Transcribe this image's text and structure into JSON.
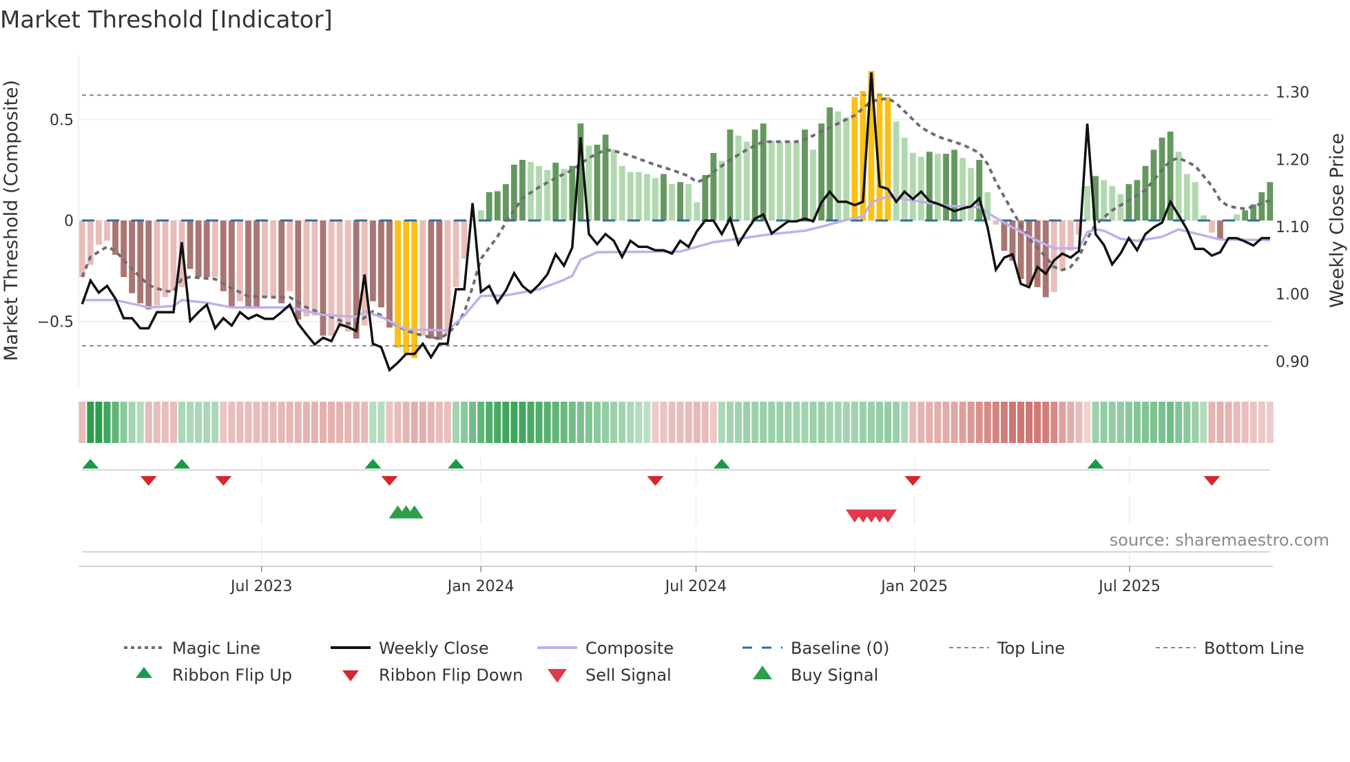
{
  "title": "Market Threshold [Indicator]",
  "source": "source: sharemaestro.com",
  "chart_data": {
    "type": "bar",
    "title": "Market Threshold [Indicator]",
    "ylabel_left": "Market Threshold (Composite)",
    "ylabel_right": "Weekly Close Price",
    "ylim_left": [
      -0.8,
      0.8
    ],
    "ylim_right": [
      0.87,
      1.34
    ],
    "left_ticks": [
      {
        "v": 0.5,
        "label": "0.5"
      },
      {
        "v": 0,
        "label": "0"
      },
      {
        "v": -0.5,
        "label": "−0.5"
      }
    ],
    "right_ticks": [
      {
        "v": 1.3,
        "label": "1.30"
      },
      {
        "v": 1.2,
        "label": "1.20"
      },
      {
        "v": 1.1,
        "label": "1.10"
      },
      {
        "v": 1.0,
        "label": "1.00"
      },
      {
        "v": 0.9,
        "label": "0.90"
      }
    ],
    "x_unit": "week index (1 = first weekly bar)",
    "x_ticks": [
      {
        "week": 22.6,
        "label": "Jul 2023"
      },
      {
        "week": 49.0,
        "label": "Jan 2024"
      },
      {
        "week": 74.9,
        "label": "Jul 2024"
      },
      {
        "week": 101.2,
        "label": "Jan 2025"
      },
      {
        "week": 127.1,
        "label": "Jul 2025"
      }
    ],
    "top_line": 0.62,
    "bottom_line": -0.62,
    "baseline": 0,
    "colors": {
      "bar_pos_dark": "#64985f",
      "bar_pos_light": "#b1d9ae",
      "bar_neg_dark": "#ab7572",
      "bar_neg_light": "#ebbdb8",
      "bar_extreme": "#fbc012",
      "weekly_close": "#111111",
      "composite": "#bcb1ec",
      "magic": "#6d6d74",
      "baseline": "#2e6e9e",
      "threshold": "#888888",
      "ribbon_up": "#2e9e4e",
      "ribbon_down": "#c55a56",
      "flip_up": "#1a9a48",
      "flip_down": "#d7262b",
      "buy": "#2ca048",
      "sell": "#e13a4c"
    },
    "composite_bars": [
      -0.28,
      -0.22,
      -0.12,
      -0.1,
      -0.17,
      -0.28,
      -0.36,
      -0.41,
      -0.44,
      -0.42,
      -0.38,
      -0.35,
      -0.33,
      -0.24,
      -0.28,
      -0.28,
      -0.28,
      -0.35,
      -0.43,
      -0.4,
      -0.43,
      -0.43,
      -0.38,
      -0.375,
      -0.41,
      -0.35,
      -0.49,
      -0.475,
      -0.47,
      -0.57,
      -0.57,
      -0.53,
      -0.55,
      -0.585,
      -0.52,
      -0.4,
      -0.43,
      -0.53,
      -0.63,
      -0.66,
      -0.68,
      -0.57,
      -0.585,
      -0.59,
      -0.56,
      -0.33,
      -0.19,
      0,
      0.05,
      0.14,
      0.145,
      0.18,
      0.276,
      0.3,
      0.29,
      0.27,
      0.25,
      0.286,
      0.255,
      0.27,
      0.48,
      0.37,
      0.375,
      0.425,
      0.35,
      0.27,
      0.24,
      0.24,
      0.23,
      0.21,
      0.23,
      0.18,
      0.19,
      0.18,
      0.09,
      0.225,
      0.334,
      0.295,
      0.45,
      0.42,
      0.39,
      0.45,
      0.48,
      0.395,
      0.39,
      0.39,
      0.386,
      0.45,
      0.35,
      0.48,
      0.56,
      0.54,
      0.51,
      0.61,
      0.64,
      0.74,
      0.63,
      0.61,
      0.49,
      0.41,
      0.335,
      0.315,
      0.34,
      0.33,
      0.33,
      0.35,
      0.31,
      0.26,
      0.3,
      0.14,
      -0.02,
      -0.15,
      -0.2,
      -0.29,
      -0.32,
      -0.33,
      -0.38,
      -0.355,
      -0.25,
      -0.15,
      -0.07,
      0.17,
      0.22,
      0.2,
      0.17,
      0.13,
      0.18,
      0.2,
      0.27,
      0.35,
      0.41,
      0.44,
      0.34,
      0.23,
      0.19,
      0.025,
      -0.06,
      -0.09,
      0,
      0.03,
      0.05,
      0.08,
      0.14,
      0.19
    ],
    "bar_shade": "LLLLDDDDDLLLLDDDLDDLDDLLDLDLLDLLLDLDDDYYYLDDLLLLLDDDDDLLLDLDDLDDLLLLLLDLDLLDDLDLLDDLLLLDLDDLLYYYYYLLLLDLDDLLDLLDDDDDDLLLLLDLLLDDDDDDLLLLLDLLDDDD",
    "weekly_close": [
      0.985,
      1.02,
      1.002,
      1.012,
      0.993,
      0.964,
      0.964,
      0.949,
      0.949,
      0.973,
      0.973,
      0.973,
      1.077,
      0.96,
      0.973,
      0.984,
      0.949,
      0.964,
      0.953,
      0.973,
      0.963,
      0.969,
      0.963,
      0.963,
      0.973,
      0.984,
      0.956,
      0.94,
      0.925,
      0.935,
      0.93,
      0.955,
      0.951,
      0.945,
      1.029,
      0.926,
      0.921,
      0.887,
      0.898,
      0.911,
      0.911,
      0.926,
      0.906,
      0.926,
      0.926,
      1.007,
      1.007,
      1.135,
      1.003,
      1.012,
      0.987,
      1.005,
      1.031,
      1.012,
      1.002,
      1.014,
      1.029,
      1.059,
      1.042,
      1.069,
      1.233,
      1.089,
      1.074,
      1.089,
      1.079,
      1.055,
      1.079,
      1.07,
      1.07,
      1.065,
      1.065,
      1.06,
      1.079,
      1.07,
      1.093,
      1.109,
      1.109,
      1.089,
      1.112,
      1.074,
      1.094,
      1.112,
      1.118,
      1.09,
      1.099,
      1.108,
      1.108,
      1.112,
      1.108,
      1.136,
      1.152,
      1.137,
      1.137,
      1.132,
      1.137,
      1.329,
      1.16,
      1.156,
      1.137,
      1.152,
      1.141,
      1.152,
      1.138,
      1.134,
      1.129,
      1.123,
      1.127,
      1.13,
      1.142,
      1.099,
      1.036,
      1.054,
      1.059,
      1.015,
      1.01,
      1.04,
      1.03,
      1.05,
      1.06,
      1.054,
      1.064,
      1.253,
      1.089,
      1.073,
      1.044,
      1.06,
      1.083,
      1.065,
      1.089,
      1.099,
      1.106,
      1.137,
      1.117,
      1.096,
      1.067,
      1.067,
      1.057,
      1.062,
      1.083,
      1.083,
      1.078,
      1.072,
      1.083,
      1.083
    ],
    "composite_line": [
      [
        1,
        0.991
      ],
      [
        5,
        0.991
      ],
      [
        9,
        0.98
      ],
      [
        12,
        0.982
      ],
      [
        13,
        0.991
      ],
      [
        16,
        0.987
      ],
      [
        19,
        0.98
      ],
      [
        26,
        0.98
      ],
      [
        30,
        0.969
      ],
      [
        34,
        0.966
      ],
      [
        35,
        0.974
      ],
      [
        37,
        0.966
      ],
      [
        40,
        0.947
      ],
      [
        45,
        0.946
      ],
      [
        47,
        0.968
      ],
      [
        49,
        0.997
      ],
      [
        52,
        0.998
      ],
      [
        56,
        1.007
      ],
      [
        59,
        1.021
      ],
      [
        60,
        1.027
      ],
      [
        61,
        1.051
      ],
      [
        63,
        1.062
      ],
      [
        73,
        1.063
      ],
      [
        77,
        1.077
      ],
      [
        80,
        1.082
      ],
      [
        84,
        1.089
      ],
      [
        88,
        1.094
      ],
      [
        90,
        1.1
      ],
      [
        93,
        1.11
      ],
      [
        95,
        1.115
      ],
      [
        96,
        1.136
      ],
      [
        98,
        1.145
      ],
      [
        100,
        1.141
      ],
      [
        105,
        1.131
      ],
      [
        109,
        1.129
      ],
      [
        111,
        1.113
      ],
      [
        113,
        1.099
      ],
      [
        116,
        1.079
      ],
      [
        118,
        1.068
      ],
      [
        121,
        1.068
      ],
      [
        122,
        1.092
      ],
      [
        123,
        1.096
      ],
      [
        124,
        1.094
      ],
      [
        126,
        1.082
      ],
      [
        128,
        1.079
      ],
      [
        131,
        1.085
      ],
      [
        133,
        1.096
      ],
      [
        135,
        1.09
      ],
      [
        138,
        1.081
      ],
      [
        144,
        1.08
      ]
    ],
    "magic_line": [
      [
        1,
        -0.28
      ],
      [
        2,
        -0.18
      ],
      [
        4,
        -0.13
      ],
      [
        5,
        -0.15
      ],
      [
        7,
        -0.24
      ],
      [
        9,
        -0.32
      ],
      [
        11,
        -0.35
      ],
      [
        12,
        -0.35
      ],
      [
        13,
        -0.29
      ],
      [
        14,
        -0.28
      ],
      [
        17,
        -0.29
      ],
      [
        19,
        -0.335
      ],
      [
        21,
        -0.375
      ],
      [
        24,
        -0.38
      ],
      [
        26,
        -0.38
      ],
      [
        28,
        -0.43
      ],
      [
        33,
        -0.51
      ],
      [
        34,
        -0.51
      ],
      [
        35,
        -0.48
      ],
      [
        36,
        -0.45
      ],
      [
        37,
        -0.47
      ],
      [
        38,
        -0.5
      ],
      [
        40,
        -0.545
      ],
      [
        42,
        -0.57
      ],
      [
        44,
        -0.585
      ],
      [
        45,
        -0.56
      ],
      [
        46,
        -0.52
      ],
      [
        47,
        -0.455
      ],
      [
        48,
        -0.33
      ],
      [
        49,
        -0.19
      ],
      [
        51,
        -0.08
      ],
      [
        52,
        -0.01
      ],
      [
        53,
        0.05
      ],
      [
        54,
        0.11
      ],
      [
        56,
        0.165
      ],
      [
        58,
        0.21
      ],
      [
        60,
        0.25
      ],
      [
        62,
        0.31
      ],
      [
        64,
        0.35
      ],
      [
        65,
        0.345
      ],
      [
        67,
        0.32
      ],
      [
        70,
        0.275
      ],
      [
        72,
        0.25
      ],
      [
        74,
        0.22
      ],
      [
        75,
        0.19
      ],
      [
        76,
        0.205
      ],
      [
        77,
        0.24
      ],
      [
        79,
        0.3
      ],
      [
        81,
        0.35
      ],
      [
        83,
        0.39
      ],
      [
        87,
        0.39
      ],
      [
        88,
        0.4
      ],
      [
        90,
        0.44
      ],
      [
        92,
        0.48
      ],
      [
        94,
        0.52
      ],
      [
        96,
        0.59
      ],
      [
        98,
        0.605
      ],
      [
        99,
        0.58
      ],
      [
        101,
        0.5
      ],
      [
        102,
        0.46
      ],
      [
        104,
        0.415
      ],
      [
        107,
        0.375
      ],
      [
        109,
        0.335
      ],
      [
        110,
        0.28
      ],
      [
        111,
        0.19
      ],
      [
        113,
        0.045
      ],
      [
        115,
        -0.09
      ],
      [
        117,
        -0.18
      ],
      [
        118,
        -0.23
      ],
      [
        119,
        -0.245
      ],
      [
        120,
        -0.23
      ],
      [
        121,
        -0.18
      ],
      [
        122,
        -0.09
      ],
      [
        123,
        -0.02
      ],
      [
        125,
        0.05
      ],
      [
        127,
        0.1
      ],
      [
        129,
        0.15
      ],
      [
        131,
        0.25
      ],
      [
        132,
        0.295
      ],
      [
        133,
        0.31
      ],
      [
        135,
        0.27
      ],
      [
        137,
        0.17
      ],
      [
        138,
        0.1
      ],
      [
        139,
        0.07
      ],
      [
        141,
        0.057
      ],
      [
        142,
        0.07
      ],
      [
        144,
        0.1
      ]
    ],
    "ribbon_strength": [
      -0.3,
      1.0,
      1.0,
      0.9,
      0.7,
      0.45,
      0.3,
      0.2,
      -0.3,
      -0.3,
      -0.3,
      -0.3,
      0.25,
      0.25,
      0.25,
      0.25,
      0.25,
      -0.25,
      -0.28,
      -0.3,
      -0.3,
      -0.3,
      -0.32,
      -0.32,
      -0.33,
      -0.34,
      -0.35,
      -0.36,
      -0.37,
      -0.38,
      -0.38,
      -0.36,
      -0.35,
      -0.34,
      -0.32,
      0.2,
      0.2,
      -0.25,
      -0.3,
      -0.35,
      -0.4,
      -0.4,
      -0.35,
      -0.3,
      -0.28,
      0.3,
      0.45,
      0.6,
      0.7,
      0.8,
      0.85,
      0.9,
      0.9,
      0.88,
      0.85,
      0.8,
      0.75,
      0.7,
      0.65,
      0.6,
      0.55,
      0.5,
      0.45,
      0.4,
      0.35,
      0.3,
      0.25,
      0.2,
      0.15,
      -0.2,
      -0.25,
      -0.28,
      -0.3,
      -0.3,
      -0.32,
      -0.3,
      -0.2,
      0.25,
      0.3,
      0.32,
      0.35,
      0.35,
      0.35,
      0.35,
      0.35,
      0.35,
      0.32,
      0.32,
      0.35,
      0.35,
      0.32,
      0.3,
      0.3,
      0.32,
      0.35,
      0.35,
      0.38,
      0.4,
      0.35,
      0.25,
      -0.3,
      -0.35,
      -0.38,
      -0.4,
      -0.42,
      -0.45,
      -0.5,
      -0.55,
      -0.6,
      -0.65,
      -0.7,
      -0.75,
      -0.8,
      -0.8,
      -0.8,
      -0.78,
      -0.75,
      -0.65,
      -0.5,
      -0.4,
      -0.3,
      -0.15,
      0.35,
      0.4,
      0.4,
      0.42,
      0.45,
      0.48,
      0.5,
      0.52,
      0.55,
      0.6,
      0.5,
      0.45,
      0.35,
      0.2,
      -0.35,
      -0.38,
      -0.35,
      -0.32,
      -0.3,
      -0.25,
      -0.22,
      -0.18
    ],
    "ribbon_flip_up": [
      2,
      13,
      36,
      46,
      78,
      123
    ],
    "ribbon_flip_down": [
      9,
      18,
      38,
      70,
      101,
      137
    ],
    "buy_signals": [
      39,
      40,
      41
    ],
    "sell_signals": [
      94,
      95,
      96,
      97,
      98
    ],
    "legend": [
      {
        "label": "Magic Line",
        "kind": "magic"
      },
      {
        "label": "Weekly Close",
        "kind": "close"
      },
      {
        "label": "Composite",
        "kind": "composite"
      },
      {
        "label": "Baseline (0)",
        "kind": "baseline"
      },
      {
        "label": "Top Line",
        "kind": "top"
      },
      {
        "label": "Bottom Line",
        "kind": "bottom"
      },
      {
        "label": "Ribbon Flip Up",
        "kind": "flipup"
      },
      {
        "label": "Ribbon Flip Down",
        "kind": "flipdown"
      },
      {
        "label": "Sell Signal",
        "kind": "sell"
      },
      {
        "label": "Buy Signal",
        "kind": "buy"
      }
    ]
  }
}
